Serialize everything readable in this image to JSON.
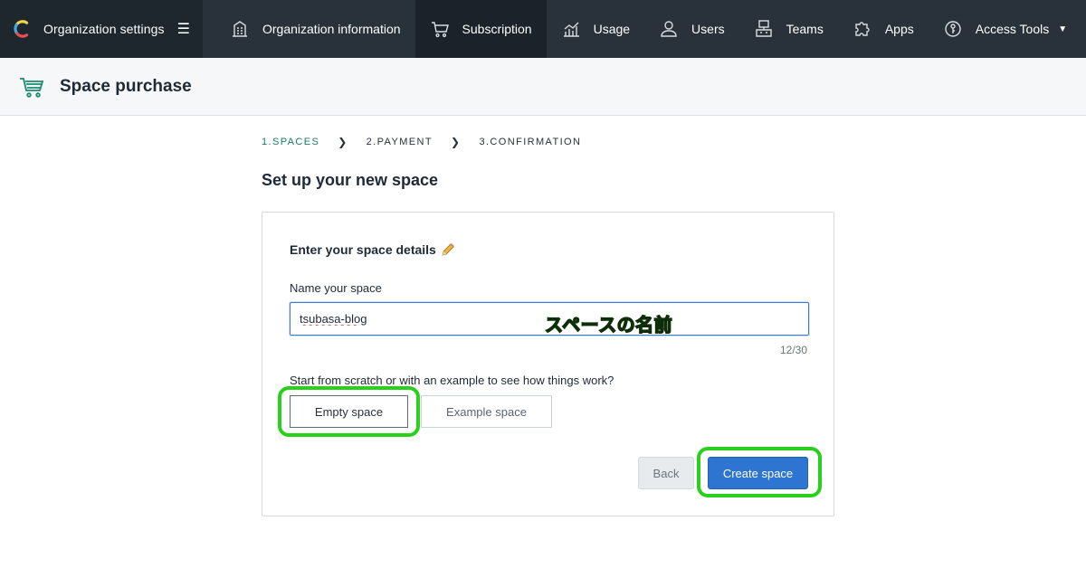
{
  "topbar": {
    "org_label": "Organization settings",
    "menu_icon": "hamburger-icon",
    "nav": [
      {
        "label": "Organization information",
        "icon": "building-icon"
      },
      {
        "label": "Subscription",
        "icon": "cart-icon",
        "active": true
      },
      {
        "label": "Usage",
        "icon": "chart-icon"
      },
      {
        "label": "Users",
        "icon": "user-icon"
      },
      {
        "label": "Teams",
        "icon": "teams-icon"
      },
      {
        "label": "Apps",
        "icon": "puzzle-icon"
      },
      {
        "label": "Access Tools",
        "icon": "key-icon",
        "dropdown": true
      }
    ]
  },
  "page": {
    "title": "Space purchase",
    "icon": "cart-icon"
  },
  "steps": [
    "1.SPACES",
    "2.PAYMENT",
    "3.CONFIRMATION"
  ],
  "section_title": "Set up your new space",
  "card": {
    "title": "Enter your space details",
    "name_label": "Name your space",
    "name_value": "tsubasa-blog",
    "annotation": "スペースの名前",
    "counter": "12/30",
    "choice_label": "Start from scratch or with an example to see how things work?",
    "options": [
      "Empty space",
      "Example space"
    ],
    "back_label": "Back",
    "create_label": "Create space"
  },
  "colors": {
    "topbar": "#29323b",
    "accent": "#2e75d1",
    "current_step": "#1a7a63",
    "highlight": "#29d11d"
  }
}
